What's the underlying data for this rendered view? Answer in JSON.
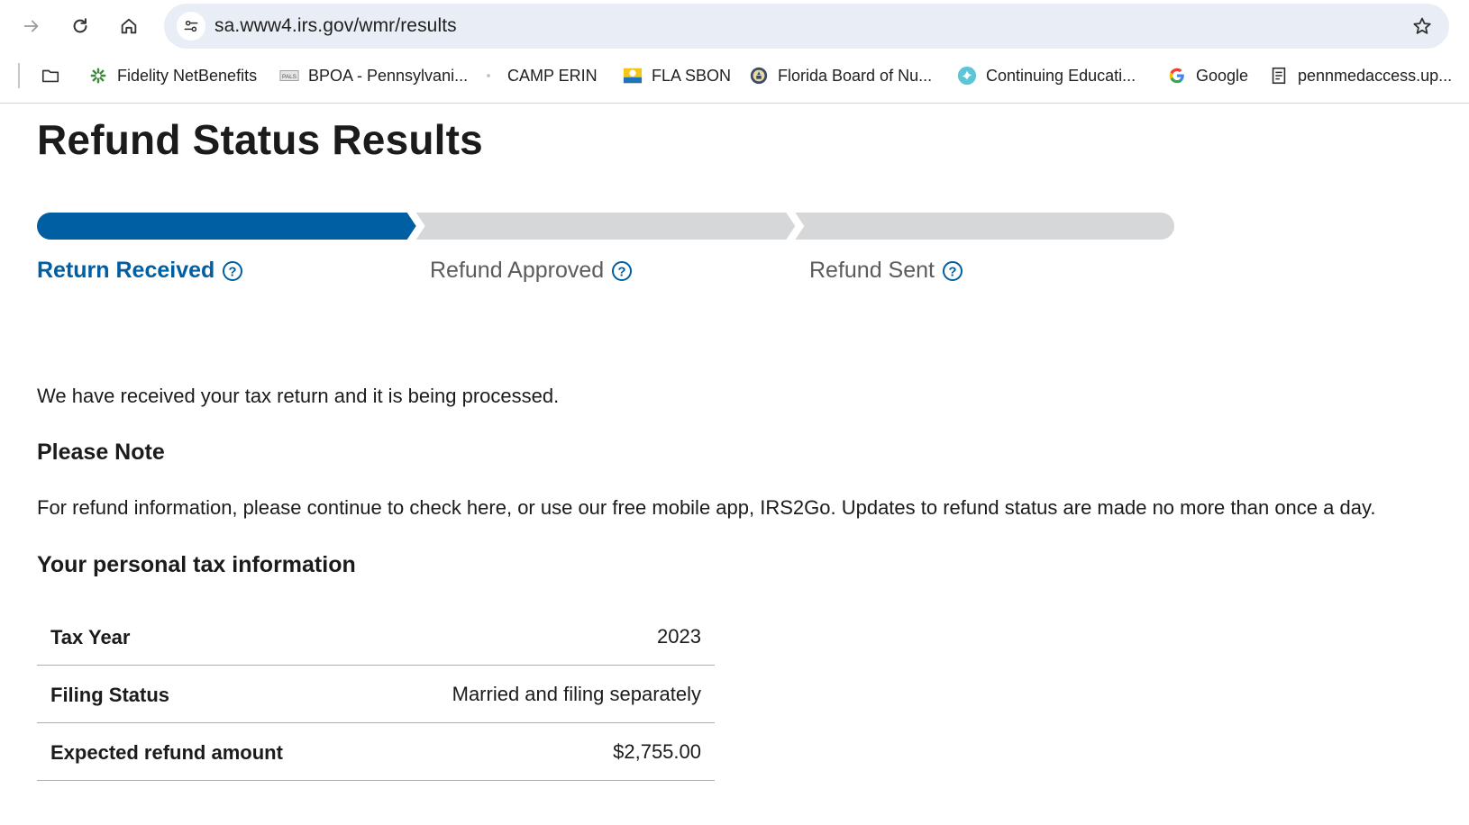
{
  "browser": {
    "url": "sa.www4.irs.gov/wmr/results",
    "bookmarks": [
      {
        "label": "Fidelity NetBenefits",
        "icon": "fidelity-icon"
      },
      {
        "label": "BPOA - Pennsylvani...",
        "icon": "pals-icon"
      },
      {
        "label": "CAMP ERIN",
        "icon": "dot-icon"
      },
      {
        "label": "FLA SBON",
        "icon": "florida-health-icon"
      },
      {
        "label": "Florida Board of Nu...",
        "icon": "seal-icon"
      },
      {
        "label": "Continuing Educati...",
        "icon": "bird-icon"
      },
      {
        "label": "Google",
        "icon": "google-icon"
      },
      {
        "label": "pennmedaccess.up...",
        "icon": "page-icon"
      }
    ]
  },
  "page": {
    "title": "Refund Status Results",
    "tracker": {
      "steps": [
        {
          "label": "Return Received",
          "state": "complete"
        },
        {
          "label": "Refund Approved",
          "state": "pending"
        },
        {
          "label": "Refund Sent",
          "state": "pending"
        }
      ],
      "active_color": "#005ea2",
      "inactive_color": "#d6d7d9"
    },
    "status_message": "We have received your tax return and it is being processed.",
    "note_heading": "Please Note",
    "note_body": "For refund information, please continue to check here, or use our free mobile app, IRS2Go. Updates to refund status are made no more than once a day.",
    "info_heading": "Your personal tax information",
    "info_rows": [
      {
        "label": "Tax Year",
        "value": "2023"
      },
      {
        "label": "Filing Status",
        "value": "Married and filing separately"
      },
      {
        "label": "Expected refund amount",
        "value": "$2,755.00"
      }
    ]
  }
}
